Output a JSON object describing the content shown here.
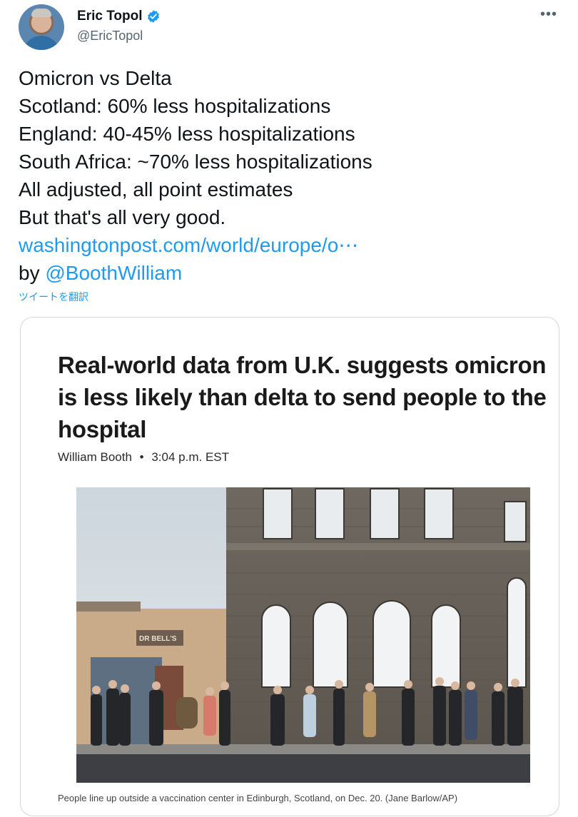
{
  "author": {
    "name": "Eric Topol",
    "handle": "@EricTopol",
    "verified": true,
    "more_icon": "more-horizontal-icon"
  },
  "tweet": {
    "lines": [
      "Omicron vs Delta",
      "Scotland: 60% less hospitalizations",
      "England: 40-45% less hospitalizations",
      "South Africa: ~70% less hospitalizations",
      "All adjusted, all point estimates",
      "But that's all very good."
    ],
    "link": "washingtonpost.com/world/europe/o⋯",
    "by_prefix": "by ",
    "mention": "@BoothWilliam",
    "translate": "ツイートを翻訳"
  },
  "card": {
    "headline": "Real-world data from U.K. suggests omicron is less likely than delta to send people to the hospital",
    "byline_author": "William Booth",
    "byline_separator": "•",
    "byline_time": "3:04 p.m. EST",
    "photo_sign": "DR BELL'S",
    "caption": "People line up outside a vaccination center in Edinburgh, Scotland, on Dec. 20. (Jane Barlow/AP)"
  },
  "colors": {
    "link": "#1d9bf0",
    "verified_badge": "#1d9bf0",
    "text": "#0f1419",
    "secondary": "#536471"
  }
}
